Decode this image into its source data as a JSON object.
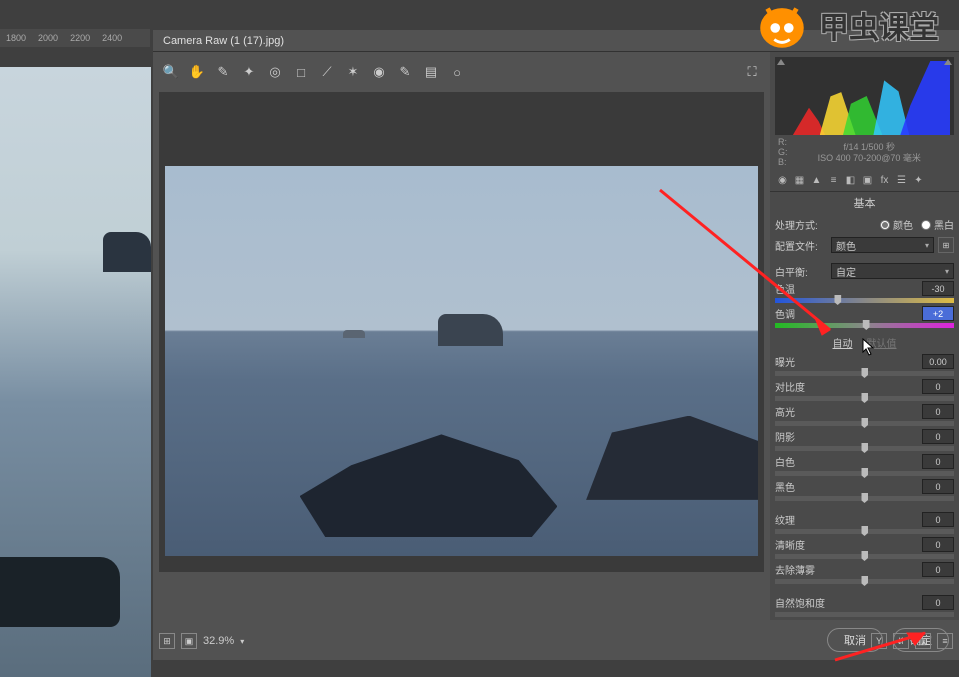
{
  "ruler": {
    "marks": [
      "1800",
      "2000",
      "2200",
      "2400"
    ]
  },
  "window": {
    "title": "Camera Raw (1 (17).jpg)"
  },
  "footer": {
    "zoom": "32.9%"
  },
  "rgb": {
    "r": "R:",
    "g": "G:",
    "b": "B:"
  },
  "meta": {
    "line1": "f/14  1/500 秒",
    "line2": "ISO 400  70-200@70 毫米"
  },
  "panel": {
    "title": "基本",
    "treat_label": "处理方式:",
    "radio_color": "颜色",
    "radio_bw": "黑白",
    "profile_label": "配置文件:",
    "profile_value": "颜色",
    "wb_label": "白平衡:",
    "wb_value": "自定",
    "temp_label": "色温",
    "temp_value": "-30",
    "tint_label": "色调",
    "tint_value": "+2",
    "auto": "自动",
    "default": "默认值",
    "sliders": [
      {
        "label": "曝光",
        "value": "0.00",
        "pos": 50
      },
      {
        "label": "对比度",
        "value": "0",
        "pos": 50
      },
      {
        "label": "高光",
        "value": "0",
        "pos": 50
      },
      {
        "label": "阴影",
        "value": "0",
        "pos": 50
      },
      {
        "label": "白色",
        "value": "0",
        "pos": 50
      },
      {
        "label": "黑色",
        "value": "0",
        "pos": 50
      }
    ],
    "sliders2": [
      {
        "label": "纹理",
        "value": "0",
        "pos": 50
      },
      {
        "label": "清晰度",
        "value": "0",
        "pos": 50
      },
      {
        "label": "去除薄雾",
        "value": "0",
        "pos": 50
      }
    ],
    "vibrance_label": "自然饱和度",
    "vibrance_value": "0"
  },
  "buttons": {
    "cancel": "取消",
    "ok": "确定"
  },
  "logo": {
    "text": "甲虫课堂"
  }
}
